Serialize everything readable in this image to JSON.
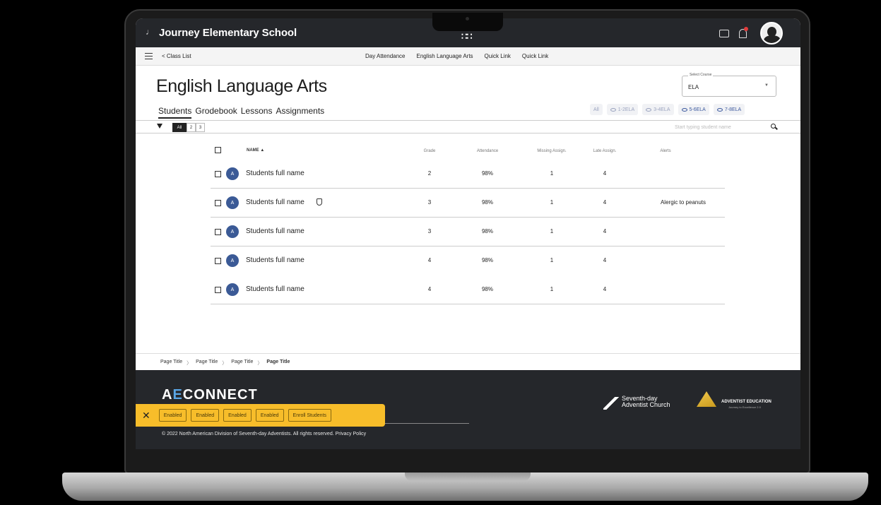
{
  "topbar": {
    "school": "Journey Elementary School"
  },
  "nav": {
    "back": "< Class List",
    "links": [
      "Day Attendance",
      "English Language Arts",
      "Quick Link",
      "Quick Link"
    ]
  },
  "page": {
    "title": "English Language Arts",
    "select_label": "Select Course",
    "select_value": "ELA",
    "tabs": [
      "Students",
      "Grodebook",
      "Lessons",
      "Assignments"
    ],
    "chips": [
      "All",
      "1-2ELA",
      "3-4ELA",
      "5-6ELA",
      "7-8ELA"
    ]
  },
  "filter": {
    "segments": [
      "All",
      "2",
      "3"
    ],
    "search_placeholder": "Start typing student name"
  },
  "table": {
    "headers": {
      "name": "NAME ▲",
      "grade": "Grade",
      "attendance": "Attendance",
      "missing": "Missing Assign.",
      "late": "Late Assign.",
      "alerts": "Alerts"
    },
    "rows": [
      {
        "avatar": "A",
        "name": "Students full name",
        "grade": "2",
        "attendance": "98%",
        "missing": "1",
        "late": "4",
        "alert": ""
      },
      {
        "avatar": "A",
        "name": "Students full name",
        "grade": "3",
        "attendance": "98%",
        "missing": "1",
        "late": "4",
        "alert": "Alergic to peanuts"
      },
      {
        "avatar": "A",
        "name": "Students full name",
        "grade": "3",
        "attendance": "98%",
        "missing": "1",
        "late": "4",
        "alert": ""
      },
      {
        "avatar": "A",
        "name": "Students full name",
        "grade": "4",
        "attendance": "98%",
        "missing": "1",
        "late": "4",
        "alert": ""
      },
      {
        "avatar": "A",
        "name": "Students full name",
        "grade": "4",
        "attendance": "98%",
        "missing": "1",
        "late": "4",
        "alert": ""
      }
    ]
  },
  "breadcrumb": [
    "Page Title",
    "Page Title",
    "Page Title",
    "Page Title"
  ],
  "footer": {
    "logo_a": "A",
    "logo_e": "E",
    "logo_rest": "CONNECT",
    "copyright": "© 2022 North American Division of Seventh-day Adventists. All rights reserved. Privacy Policy",
    "sda_line1": "Seventh-day",
    "sda_line2": "Adventist Church",
    "adved": "ADVENTIST EDUCATION",
    "adved_sub": "Journey to Excellence 2.0"
  },
  "toast": {
    "buttons": [
      "Enabled",
      "Enabled",
      "Enabled",
      "Enabled",
      "Enroll Students"
    ]
  }
}
